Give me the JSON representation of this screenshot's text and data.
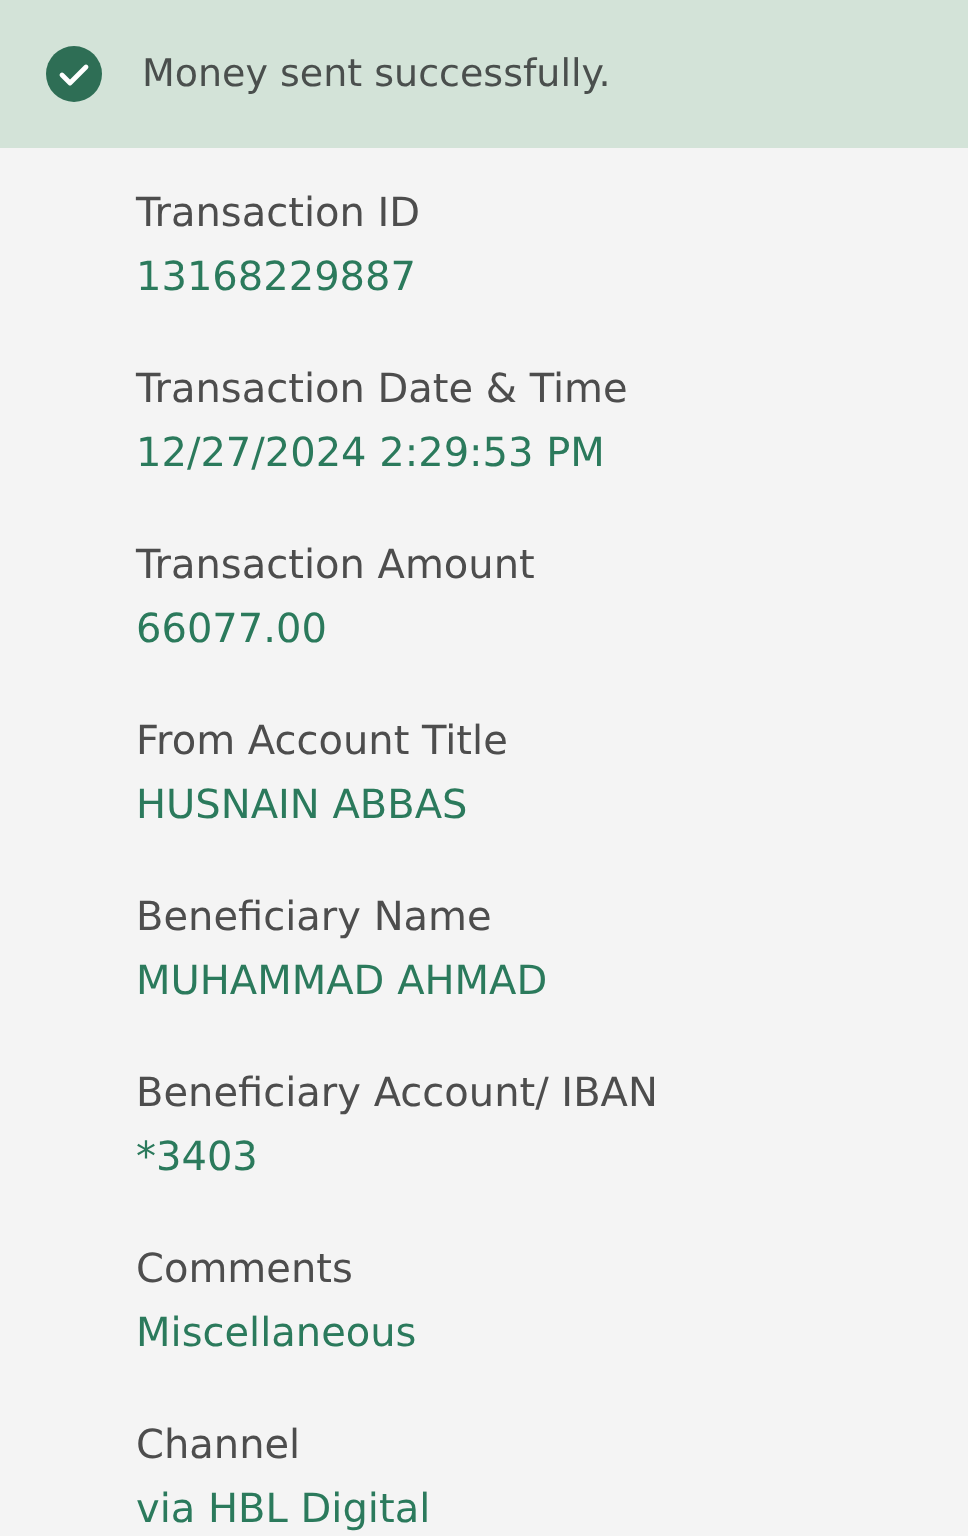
{
  "banner": {
    "message": "Money sent successfully."
  },
  "fields": [
    {
      "label": "Transaction ID",
      "value": "13168229887"
    },
    {
      "label": "Transaction Date & Time",
      "value": "12/27/2024 2:29:53 PM"
    },
    {
      "label": "Transaction Amount",
      "value": "66077.00"
    },
    {
      "label": "From Account Title",
      "value": "HUSNAIN ABBAS"
    },
    {
      "label": "Beneficiary Name",
      "value": "MUHAMMAD AHMAD"
    },
    {
      "label": "Beneficiary Account/ IBAN",
      "value": "*3403"
    },
    {
      "label": "Comments",
      "value": "Miscellaneous"
    },
    {
      "label": "Channel",
      "value": "via HBL Digital"
    }
  ]
}
